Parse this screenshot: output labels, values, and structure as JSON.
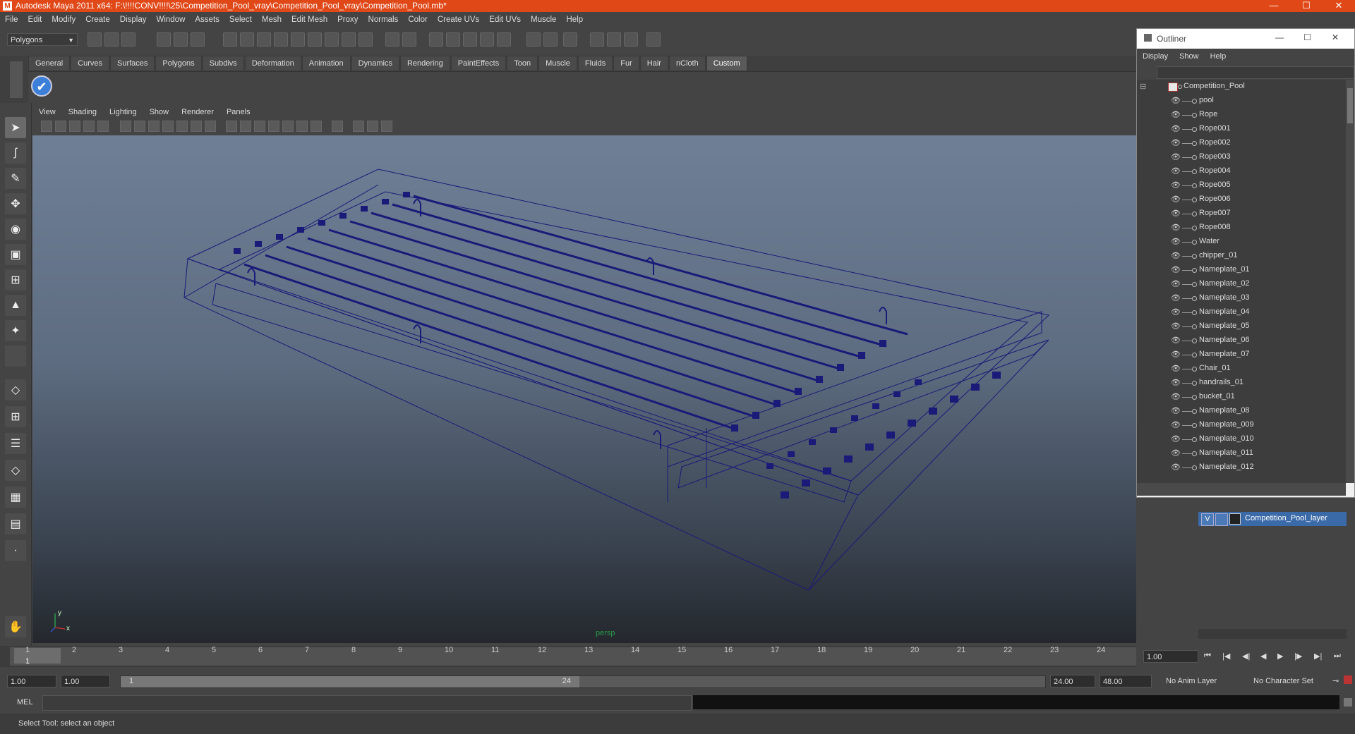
{
  "window": {
    "title": "Autodesk Maya 2011 x64: F:\\!!!!CONV!!!!\\25\\Competition_Pool_vray\\Competition_Pool_vray\\Competition_Pool.mb*",
    "min": "—",
    "max": "☐",
    "close": "✕"
  },
  "menubar": [
    "File",
    "Edit",
    "Modify",
    "Create",
    "Display",
    "Window",
    "Assets",
    "Select",
    "Mesh",
    "Edit Mesh",
    "Proxy",
    "Normals",
    "Color",
    "Create UVs",
    "Edit UVs",
    "Muscle",
    "Help"
  ],
  "statusline": {
    "mode": "Polygons"
  },
  "shelf": {
    "tabs": [
      "General",
      "Curves",
      "Surfaces",
      "Polygons",
      "Subdivs",
      "Deformation",
      "Animation",
      "Dynamics",
      "Rendering",
      "PaintEffects",
      "Toon",
      "Muscle",
      "Fluids",
      "Fur",
      "Hair",
      "nCloth",
      "Custom"
    ],
    "active_tab": "Custom"
  },
  "panel": {
    "menu": [
      "View",
      "Shading",
      "Lighting",
      "Show",
      "Renderer",
      "Panels"
    ],
    "camera_label": "persp",
    "axis_x": "x",
    "axis_y": "y"
  },
  "timeline": {
    "ticks": [
      "1",
      "2",
      "3",
      "4",
      "5",
      "6",
      "7",
      "8",
      "9",
      "10",
      "11",
      "12",
      "13",
      "14",
      "15",
      "16",
      "17",
      "18",
      "19",
      "20",
      "21",
      "22",
      "23",
      "24"
    ],
    "current_frame": "1",
    "current_time_field": "1.00"
  },
  "range": {
    "start_time": "1.00",
    "playback_start": "1.00",
    "slider_start": "1",
    "slider_end": "24",
    "playback_end": "24.00",
    "end_time": "48.00",
    "anim_layer": "No Anim Layer",
    "character_set": "No Character Set"
  },
  "command": {
    "lang": "MEL"
  },
  "help_line": "Select Tool: select an object",
  "outliner": {
    "title": "Outliner",
    "menu": [
      "Display",
      "Show",
      "Help"
    ],
    "root": "Competition_Pool",
    "items": [
      "pool",
      "Rope",
      "Rope001",
      "Rope002",
      "Rope003",
      "Rope004",
      "Rope005",
      "Rope006",
      "Rope007",
      "Rope008",
      "Water",
      "chipper_01",
      "Nameplate_01",
      "Nameplate_02",
      "Nameplate_03",
      "Nameplate_04",
      "Nameplate_05",
      "Nameplate_06",
      "Nameplate_07",
      "Chair_01",
      "handrails_01",
      "bucket_01",
      "Nameplate_08",
      "Nameplate_009",
      "Nameplate_010",
      "Nameplate_011",
      "Nameplate_012"
    ]
  },
  "layers": {
    "visible_flag": "V",
    "layer_name": "Competition_Pool_layer"
  },
  "colors": {
    "title_bar": "#e04818",
    "wireframe": "#1a1a78",
    "layer_selected": "#3b6aa8"
  }
}
